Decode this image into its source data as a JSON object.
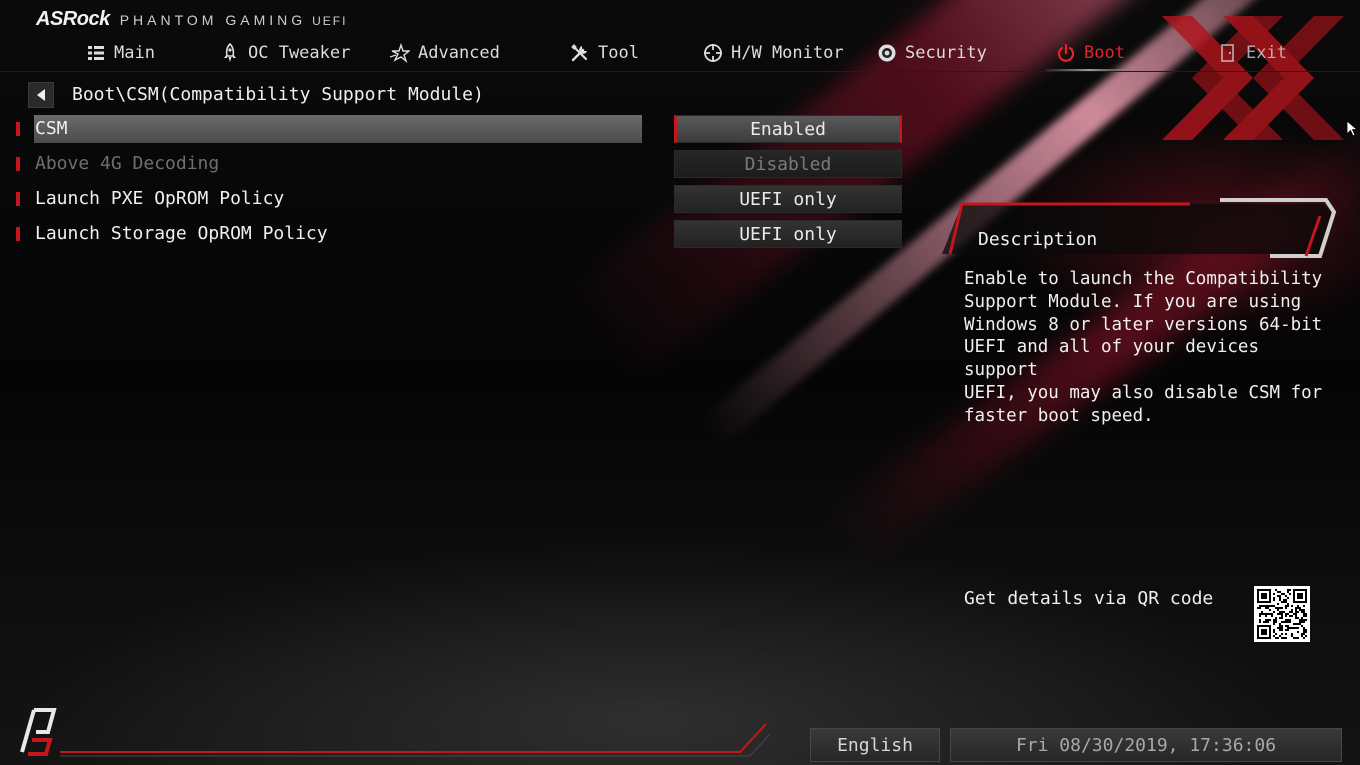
{
  "header": {
    "brand": "ASRock",
    "product": "PHANTOM GAMING",
    "product_suffix": "UEFI"
  },
  "nav": {
    "tabs": [
      {
        "label": "Main",
        "icon": "list-icon"
      },
      {
        "label": "OC Tweaker",
        "icon": "rocket-icon"
      },
      {
        "label": "Advanced",
        "icon": "star-icon"
      },
      {
        "label": "Tool",
        "icon": "tools-icon"
      },
      {
        "label": "H/W Monitor",
        "icon": "crosshair-icon"
      },
      {
        "label": "Security",
        "icon": "shield-icon"
      },
      {
        "label": "Boot",
        "icon": "power-icon"
      },
      {
        "label": "Exit",
        "icon": "exit-door-icon"
      }
    ],
    "active_tab": "Boot"
  },
  "breadcrumb": "Boot\\CSM(Compatibility Support Module)",
  "settings": [
    {
      "label": "CSM",
      "value": "Enabled",
      "state": "selected"
    },
    {
      "label": "Above 4G Decoding",
      "value": "Disabled",
      "state": "disabled"
    },
    {
      "label": "Launch PXE OpROM Policy",
      "value": "UEFI only",
      "state": "normal"
    },
    {
      "label": "Launch Storage OpROM Policy",
      "value": "UEFI only",
      "state": "normal"
    }
  ],
  "description": {
    "title": "Description",
    "text": "Enable to launch the Compatibility\nSupport Module. If you are using\nWindows 8 or later versions 64-bit\nUEFI and all of your devices support\nUEFI, you may also disable CSM for\nfaster boot speed."
  },
  "qr": {
    "label": "Get details via QR code"
  },
  "footer": {
    "language": "English",
    "datetime": "Fri 08/30/2019, 17:36:06"
  },
  "colors": {
    "accent_red": "#e3242b",
    "marker_red": "#c4161c",
    "background": "#070707"
  }
}
